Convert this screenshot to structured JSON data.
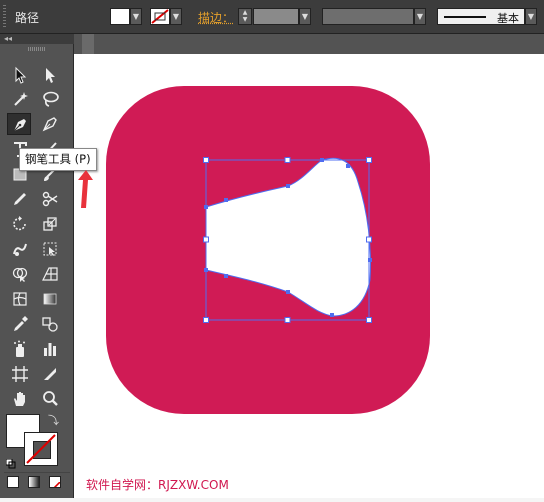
{
  "control_bar": {
    "selection_label": "路径",
    "stroke_label": "描边",
    "stroke_colon": "：",
    "profile_label": "基本"
  },
  "tooltip": {
    "text": "钢笔工具 (P)"
  },
  "canvas": {
    "icon_fill_color": "#D01B55",
    "selection_color": "#4F6CF0"
  },
  "tools": [
    {
      "name": "selection-tool-icon"
    },
    {
      "name": "direct-selection-tool-icon"
    },
    {
      "name": "magic-wand-tool-icon"
    },
    {
      "name": "lasso-tool-icon"
    },
    {
      "name": "pen-tool-icon",
      "active": true
    },
    {
      "name": "curvature-tool-icon"
    },
    {
      "name": "type-tool-icon"
    },
    {
      "name": "line-segment-tool-icon"
    },
    {
      "name": "rectangle-tool-icon"
    },
    {
      "name": "paintbrush-tool-icon"
    },
    {
      "name": "pencil-tool-icon"
    },
    {
      "name": "scissors-tool-icon"
    },
    {
      "name": "rotate-tool-icon"
    },
    {
      "name": "scale-tool-icon"
    },
    {
      "name": "warp-tool-icon"
    },
    {
      "name": "free-transform-tool-icon"
    },
    {
      "name": "shape-builder-tool-icon"
    },
    {
      "name": "perspective-grid-tool-icon"
    },
    {
      "name": "mesh-tool-icon"
    },
    {
      "name": "gradient-tool-icon"
    },
    {
      "name": "eyedropper-tool-icon"
    },
    {
      "name": "blend-tool-icon"
    },
    {
      "name": "symbol-sprayer-tool-icon"
    },
    {
      "name": "column-graph-tool-icon"
    },
    {
      "name": "artboard-tool-icon"
    },
    {
      "name": "slice-tool-icon"
    },
    {
      "name": "hand-tool-icon"
    },
    {
      "name": "zoom-tool-icon"
    }
  ],
  "watermark": "软件自学网：RJZXW.COM"
}
